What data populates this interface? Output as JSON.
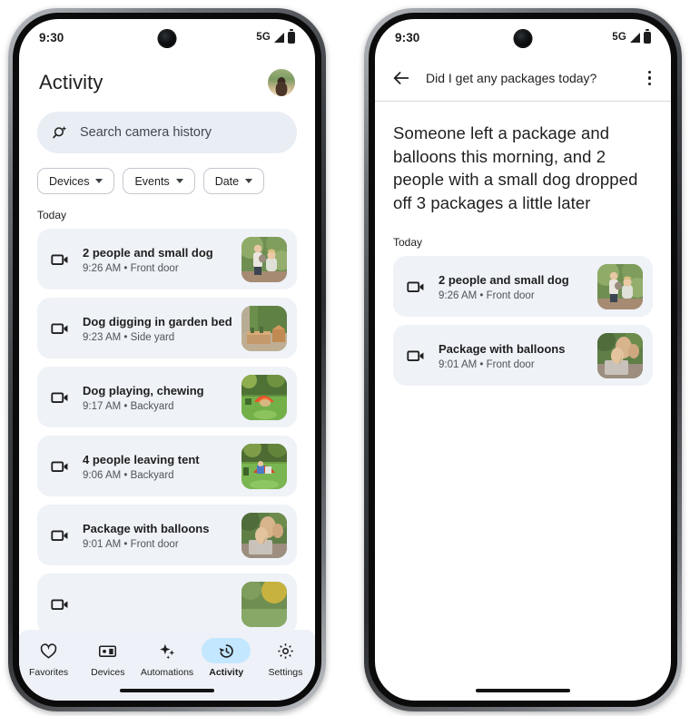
{
  "left_phone": {
    "status_bar": {
      "time": "9:30",
      "network": "5G",
      "signal_icon": "signal-triangle-icon",
      "battery_icon": "battery-full-icon"
    },
    "header": {
      "title": "Activity",
      "avatar_name": "user-avatar"
    },
    "search": {
      "placeholder": "Search camera history",
      "icon": "search-sparkle-icon"
    },
    "filters": [
      {
        "label": "Devices",
        "icon": "chevron-down-icon"
      },
      {
        "label": "Events",
        "icon": "chevron-down-icon"
      },
      {
        "label": "Date",
        "icon": "chevron-down-icon"
      }
    ],
    "section_label": "Today",
    "events": [
      {
        "title": "2 people and small dog",
        "time": "9:26 AM",
        "location": "Front door",
        "meta": "9:26 AM • Front door",
        "icon": "video-camera-icon",
        "thumb": "two-people-with-dog"
      },
      {
        "title": "Dog digging in garden bed",
        "time": "9:23 AM",
        "location": "Side yard",
        "meta": "9:23 AM • Side yard",
        "icon": "video-camera-icon",
        "thumb": "garden-bed"
      },
      {
        "title": "Dog playing, chewing",
        "time": "9:17 AM",
        "location": "Backyard",
        "meta": "9:17 AM • Backyard",
        "icon": "video-camera-icon",
        "thumb": "dog-playing-backyard"
      },
      {
        "title": "4 people leaving tent",
        "time": "9:06 AM",
        "location": "Backyard",
        "meta": "9:06 AM • Backyard",
        "icon": "video-camera-icon",
        "thumb": "people-leaving-tent"
      },
      {
        "title": "Package with balloons",
        "time": "9:01 AM",
        "location": "Front door",
        "meta": "9:01 AM • Front door",
        "icon": "video-camera-icon",
        "thumb": "package-with-balloons"
      }
    ],
    "bottom_nav": {
      "items": [
        {
          "label": "Favorites",
          "icon": "heart-icon",
          "active": false
        },
        {
          "label": "Devices",
          "icon": "devices-icon",
          "active": false
        },
        {
          "label": "Automations",
          "icon": "sparkle-icon",
          "active": false
        },
        {
          "label": "Activity",
          "icon": "history-icon",
          "active": true
        },
        {
          "label": "Settings",
          "icon": "gear-icon",
          "active": false
        }
      ],
      "active_pill_color": "#c3e7ff"
    }
  },
  "right_phone": {
    "status_bar": {
      "time": "9:30",
      "network": "5G",
      "signal_icon": "signal-triangle-icon",
      "battery_icon": "battery-full-icon"
    },
    "header": {
      "back_icon": "back-arrow-icon",
      "title": "Did I get any packages today?",
      "menu_icon": "overflow-menu-icon"
    },
    "answer": "Someone left a package and balloons this morning, and 2 people with a small dog dropped off 3 packages a little later",
    "section_label": "Today",
    "events": [
      {
        "title": "2 people and small dog",
        "time": "9:26 AM",
        "location": "Front door",
        "meta": "9:26 AM • Front door",
        "icon": "video-camera-icon",
        "thumb": "two-people-with-dog"
      },
      {
        "title": "Package with balloons",
        "time": "9:01 AM",
        "location": "Front door",
        "meta": "9:01 AM • Front door",
        "icon": "video-camera-icon",
        "thumb": "package-with-balloons"
      }
    ]
  },
  "theme": {
    "surface": "#eff2f7",
    "accent": "#c3e7ff",
    "text_primary": "#1f1f1f",
    "text_secondary": "#50545b",
    "search_bg": "#e9edf4"
  }
}
